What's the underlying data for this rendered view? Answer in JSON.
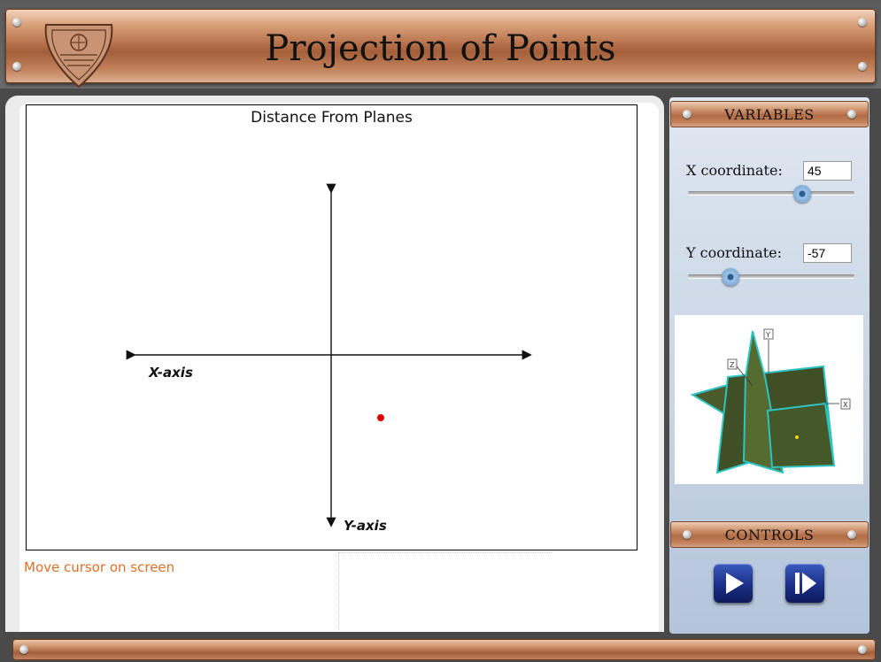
{
  "header": {
    "title": "Projection of Points"
  },
  "canvas": {
    "title": "Distance From Planes",
    "x_axis_label": "X-axis",
    "y_axis_label": "Y-axis",
    "point_color": "#e00000"
  },
  "status": {
    "message": "Move cursor on screen"
  },
  "variables": {
    "heading": "VARIABLES",
    "x": {
      "label": "X coordinate:",
      "value": "45"
    },
    "y": {
      "label": "Y coordinate:",
      "value": "-57"
    }
  },
  "preview": {
    "y_label": "Y",
    "z_label": "Z",
    "x_label": "X"
  },
  "controls": {
    "heading": "CONTROLS",
    "play_icon": "play-icon",
    "step_icon": "step-forward-icon"
  },
  "colors": {
    "accent_copper": "#b56f48",
    "status_orange": "#e07028",
    "button_blue": "#1c2f88"
  }
}
